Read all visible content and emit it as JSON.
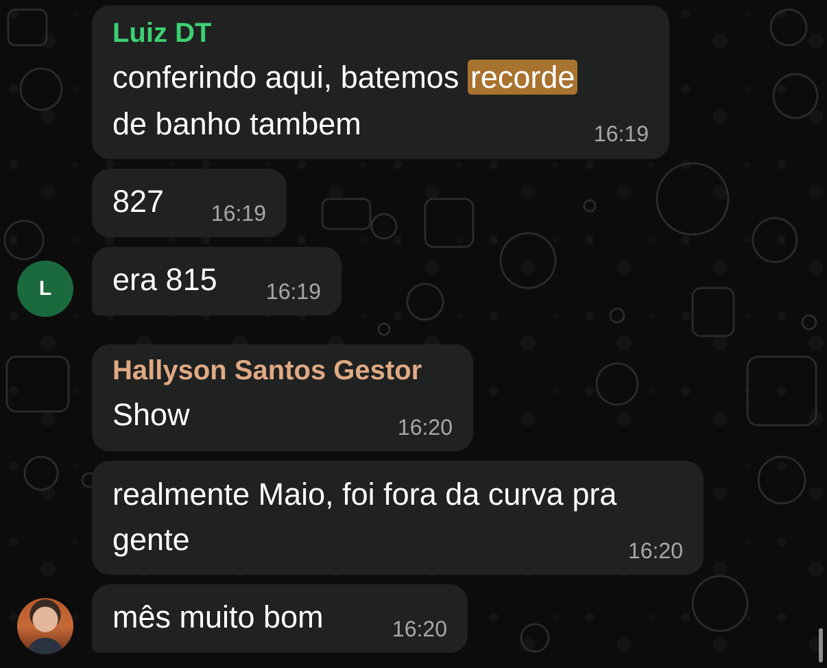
{
  "messages": [
    {
      "sender": "Luiz DT",
      "sender_color": "#3cd072",
      "text_before_highlight": "conferindo aqui, batemos ",
      "highlight": "recorde",
      "text_line2": "de banho tambem",
      "time": "16:19"
    },
    {
      "text": "827",
      "time": "16:19"
    },
    {
      "text": "era 815",
      "time": "16:19",
      "avatar_letter": "L",
      "avatar_color": "#1b6a3e"
    },
    {
      "sender": "Hallyson Santos Gestor",
      "sender_color": "#e0aa84",
      "text": "Show",
      "time": "16:20"
    },
    {
      "text_line1": "realmente Maio, foi fora da curva pra",
      "text_line2": "gente",
      "time": "16:20"
    },
    {
      "text": "mês muito bom",
      "time": "16:20"
    }
  ],
  "colors": {
    "bubble": "#202121",
    "background": "#0c0c0c",
    "highlight": "#a8722f",
    "time_text": "#a7a9a9"
  }
}
